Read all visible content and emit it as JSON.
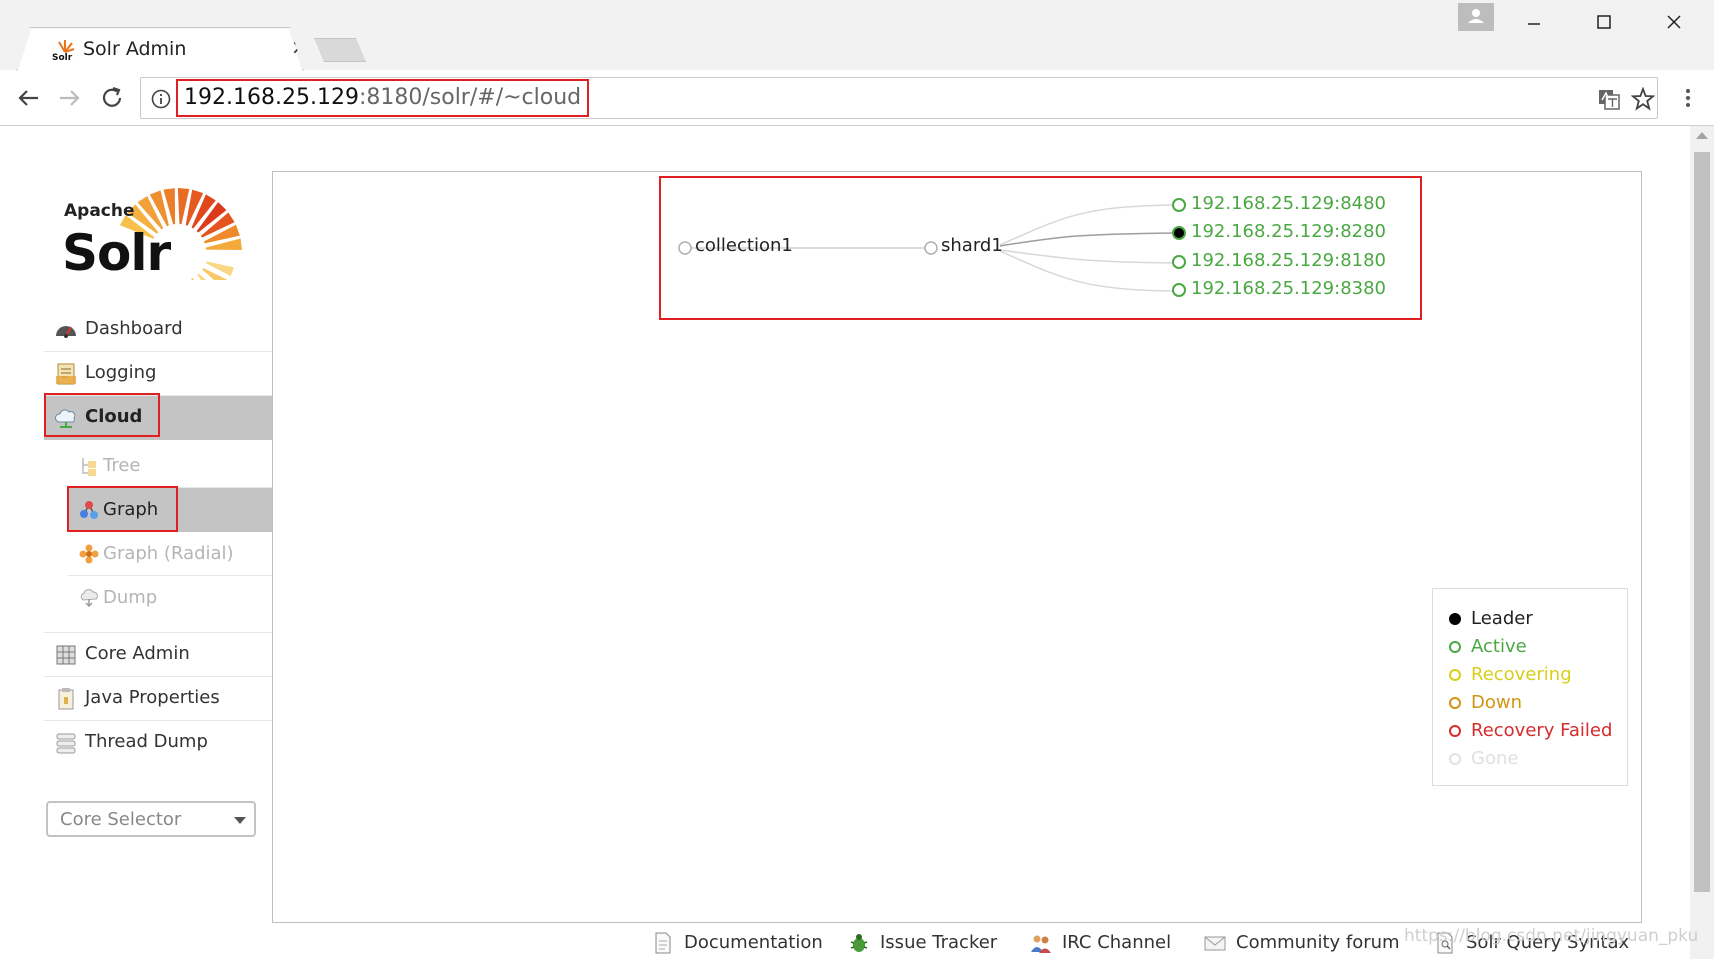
{
  "browser": {
    "tab_title": "Solr Admin",
    "tab_close": "×",
    "url_host": "192.168.25.129",
    "url_path": ":8180/solr/#/~cloud"
  },
  "logo": {
    "small": "Apache",
    "big": "Solr",
    "favicon_text": "Solr"
  },
  "sidebar": {
    "items": [
      {
        "label": "Dashboard",
        "icon": "dashboard-icon"
      },
      {
        "label": "Logging",
        "icon": "logging-icon"
      },
      {
        "label": "Cloud",
        "icon": "cloud-icon",
        "selected": true
      }
    ],
    "cloud_sub": [
      {
        "label": "Tree",
        "icon": "tree-icon"
      },
      {
        "label": "Graph",
        "icon": "graph-icon",
        "selected": true
      },
      {
        "label": "Graph (Radial)",
        "icon": "graph-radial-icon"
      },
      {
        "label": "Dump",
        "icon": "dump-icon"
      }
    ],
    "items_after": [
      {
        "label": "Core Admin",
        "icon": "core-admin-icon"
      },
      {
        "label": "Java Properties",
        "icon": "java-properties-icon"
      },
      {
        "label": "Thread Dump",
        "icon": "thread-dump-icon"
      }
    ],
    "core_selector": "Core Selector"
  },
  "graph": {
    "collection": "collection1",
    "shard": "shard1",
    "replicas": [
      {
        "label": "192.168.25.129:8480",
        "state": "active"
      },
      {
        "label": "192.168.25.129:8280",
        "state": "leader"
      },
      {
        "label": "192.168.25.129:8180",
        "state": "active"
      },
      {
        "label": "192.168.25.129:8380",
        "state": "active"
      }
    ]
  },
  "legend": [
    {
      "label": "Leader",
      "color": "#000000",
      "filled": true
    },
    {
      "label": "Active",
      "color": "#4aa842",
      "filled": false
    },
    {
      "label": "Recovering",
      "color": "#d8cf16",
      "filled": false
    },
    {
      "label": "Down",
      "color": "#d29410",
      "filled": false
    },
    {
      "label": "Recovery Failed",
      "color": "#d62c2c",
      "filled": false
    },
    {
      "label": "Gone",
      "color": "#e0e0e0",
      "filled": false
    }
  ],
  "footer": {
    "links": [
      "Documentation",
      "Issue Tracker",
      "IRC Channel",
      "Community forum",
      "Solr Query Syntax"
    ],
    "watermark": "https://blog.csdn.net/jingyuan_pku"
  },
  "colors": {
    "accent_red": "#e02020",
    "active_green": "#4aa842",
    "selected_bg": "#c4c4c4"
  }
}
